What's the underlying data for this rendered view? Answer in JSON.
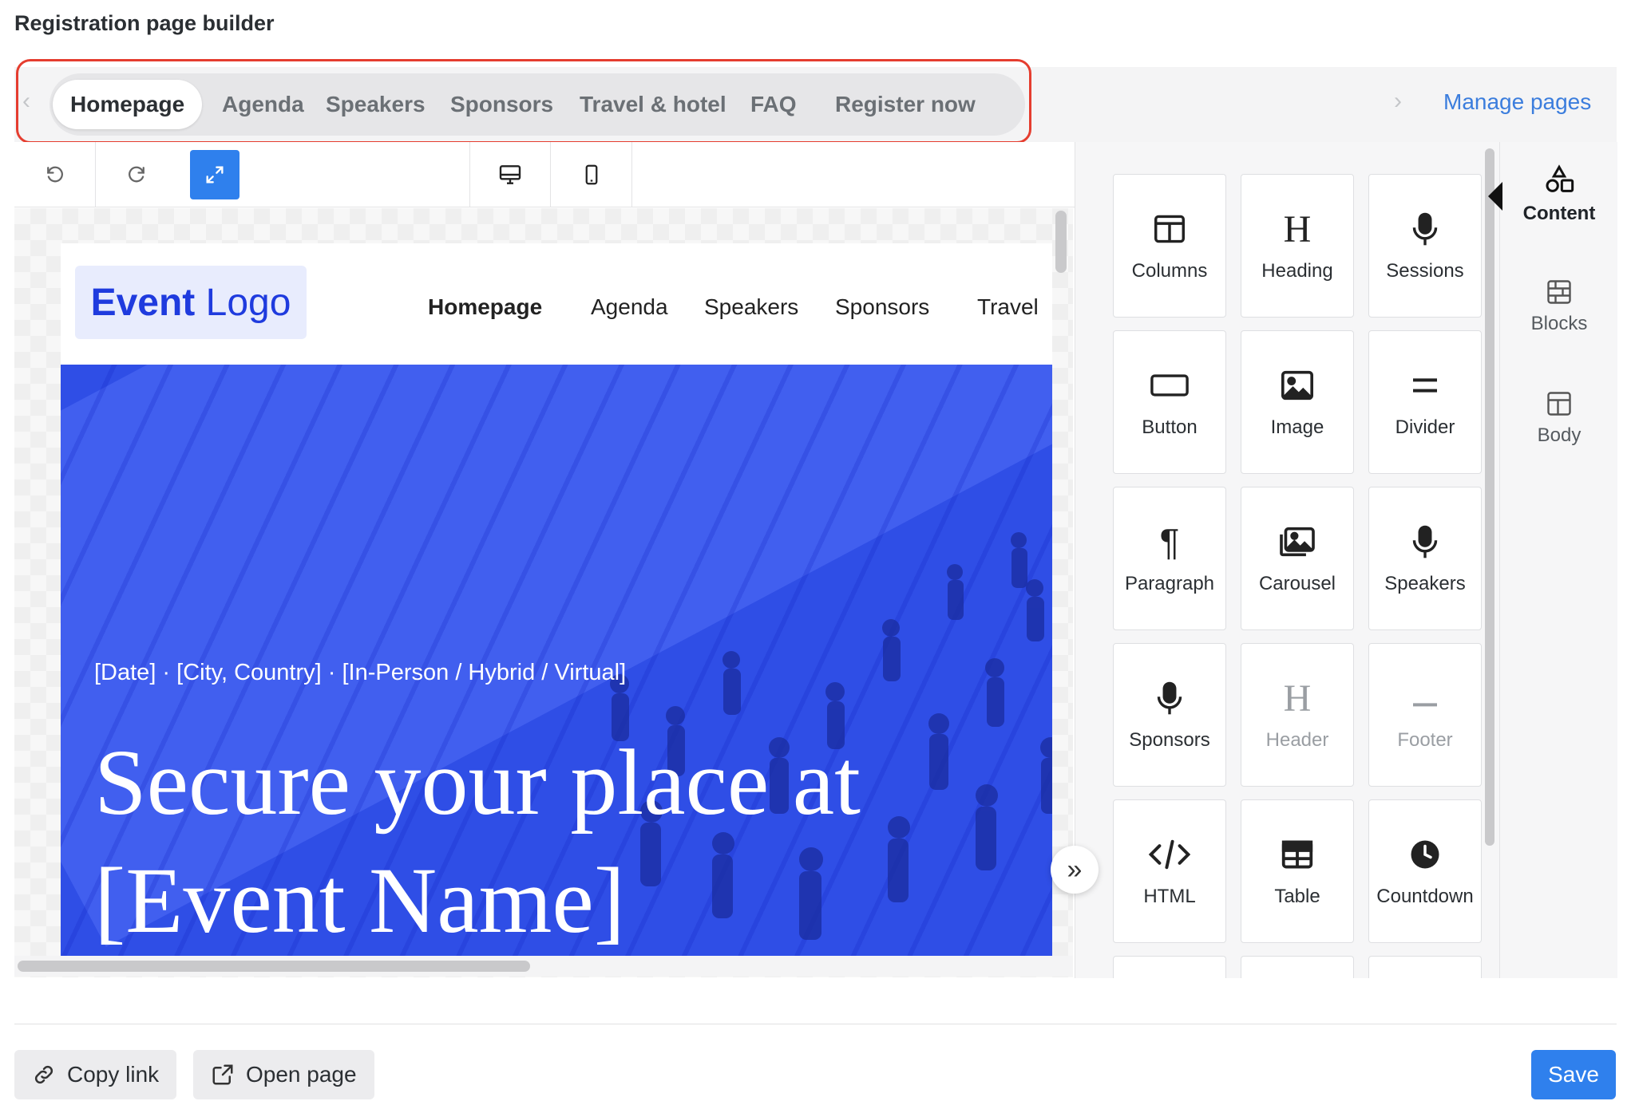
{
  "app": {
    "title": "Registration page builder"
  },
  "pages_nav": {
    "tabs": [
      {
        "label": "Homepage",
        "active": true
      },
      {
        "label": "Agenda"
      },
      {
        "label": "Speakers"
      },
      {
        "label": "Sponsors"
      },
      {
        "label": "Travel & hotel"
      },
      {
        "label": "FAQ"
      },
      {
        "label": "Register now"
      }
    ],
    "manage_label": "Manage pages",
    "highlight_color": "#e53d2f"
  },
  "toolbar": {
    "undo_icon": "undo-icon",
    "redo_icon": "redo-icon",
    "fullscreen_icon": "expand-icon",
    "desktop_icon": "desktop-icon",
    "mobile_icon": "mobile-icon",
    "accent": "#2f80ed"
  },
  "preview": {
    "logo": {
      "bold": "Event",
      "regular": " Logo"
    },
    "nav": [
      "Homepage",
      "Agenda",
      "Speakers",
      "Sponsors",
      "Travel"
    ],
    "hero_meta": "[Date] · [City, Country] · [In-Person / Hybrid / Virtual]",
    "hero_title_line1": "Secure your place at",
    "hero_title_line2": "[Event Name]",
    "hero_color": "#2f4ee6"
  },
  "content_tiles": [
    {
      "label": "Columns",
      "icon": "columns-icon"
    },
    {
      "label": "Heading",
      "icon": "heading-icon"
    },
    {
      "label": "Sessions",
      "icon": "microphone-icon"
    },
    {
      "label": "Button",
      "icon": "button-icon"
    },
    {
      "label": "Image",
      "icon": "image-icon"
    },
    {
      "label": "Divider",
      "icon": "divider-icon"
    },
    {
      "label": "Paragraph",
      "icon": "paragraph-icon"
    },
    {
      "label": "Carousel",
      "icon": "carousel-icon"
    },
    {
      "label": "Speakers",
      "icon": "microphone-icon"
    },
    {
      "label": "Sponsors",
      "icon": "microphone-icon"
    },
    {
      "label": "Header",
      "icon": "heading-icon",
      "disabled": true
    },
    {
      "label": "Footer",
      "icon": "footer-icon",
      "disabled": true
    },
    {
      "label": "HTML",
      "icon": "code-icon"
    },
    {
      "label": "Table",
      "icon": "table-icon"
    },
    {
      "label": "Countdown",
      "icon": "clock-icon"
    }
  ],
  "side_tabs": [
    {
      "label": "Content",
      "icon": "shapes-icon",
      "active": true
    },
    {
      "label": "Blocks",
      "icon": "blocks-icon"
    },
    {
      "label": "Body",
      "icon": "layout-icon"
    }
  ],
  "footer": {
    "copy_link": "Copy link",
    "open_page": "Open page",
    "save": "Save"
  }
}
